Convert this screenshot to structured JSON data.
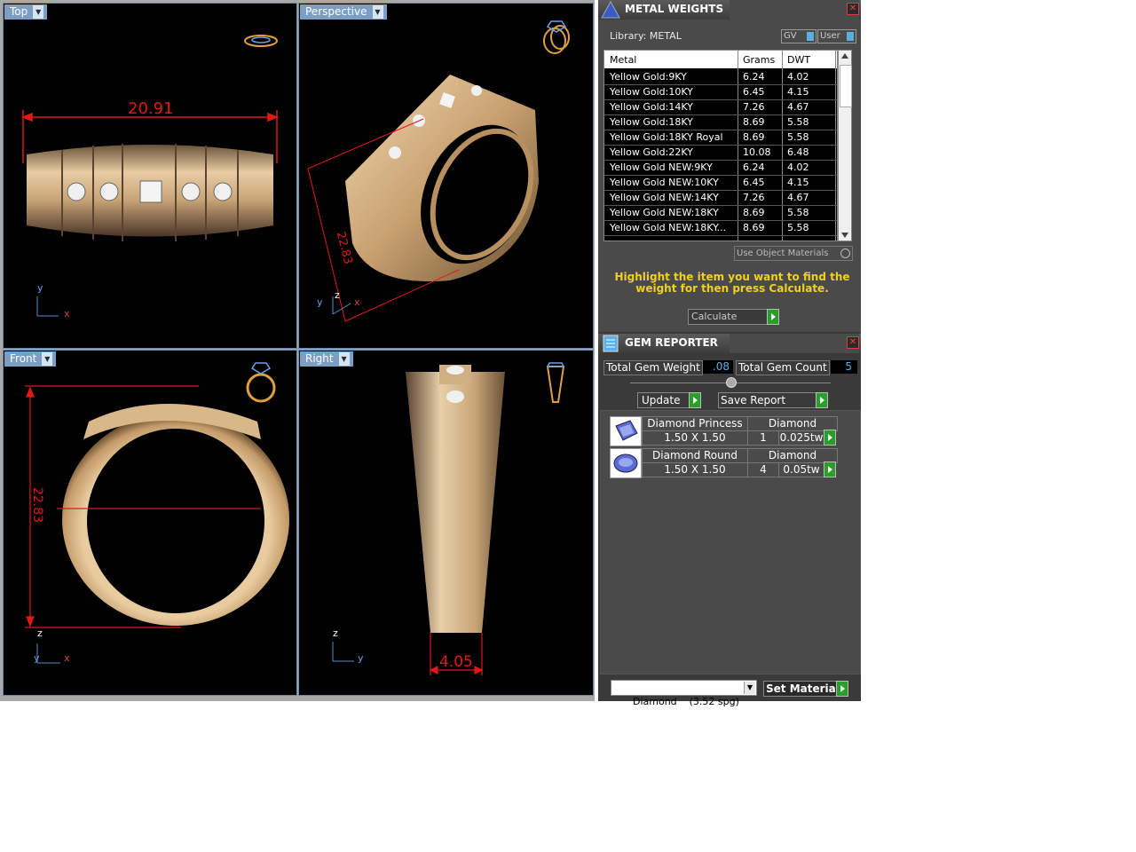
{
  "viewports": {
    "top": {
      "label": "Top",
      "dim": "20.91",
      "axis_y": "y",
      "axis_x": "x"
    },
    "perspective": {
      "label": "Perspective",
      "dim": "22.83",
      "axis_z": "z",
      "axis_y": "y",
      "axis_x": "x"
    },
    "front": {
      "label": "Front",
      "dim": "22.83",
      "axis_z": "z",
      "axis_y": "y",
      "axis_x": "x"
    },
    "right": {
      "label": "Right",
      "dim": "4.05",
      "axis_z": "z",
      "axis_y": "y"
    }
  },
  "metal_weights": {
    "title": "METAL WEIGHTS",
    "library": "Library: METAL",
    "gv_label": "GV",
    "user_label": "User",
    "columns": [
      "Metal",
      "Grams",
      "DWT"
    ],
    "rows": [
      {
        "metal": "Yellow Gold:9KY",
        "grams": "6.24",
        "dwt": "4.02"
      },
      {
        "metal": "Yellow Gold:10KY",
        "grams": "6.45",
        "dwt": "4.15"
      },
      {
        "metal": "Yellow Gold:14KY",
        "grams": "7.26",
        "dwt": "4.67"
      },
      {
        "metal": "Yellow Gold:18KY",
        "grams": "8.69",
        "dwt": "5.58"
      },
      {
        "metal": "Yellow Gold:18KY Royal",
        "grams": "8.69",
        "dwt": "5.58"
      },
      {
        "metal": "Yellow Gold:22KY",
        "grams": "10.08",
        "dwt": "6.48"
      },
      {
        "metal": "Yellow Gold NEW:9KY",
        "grams": "6.24",
        "dwt": "4.02"
      },
      {
        "metal": "Yellow Gold NEW:10KY",
        "grams": "6.45",
        "dwt": "4.15"
      },
      {
        "metal": "Yellow Gold NEW:14KY",
        "grams": "7.26",
        "dwt": "4.67"
      },
      {
        "metal": "Yellow Gold NEW:18KY",
        "grams": "8.69",
        "dwt": "5.58"
      },
      {
        "metal": "Yellow Gold NEW:18KY...",
        "grams": "8.69",
        "dwt": "5.58"
      }
    ],
    "use_object_materials": "Use Object Materials",
    "hint": "Highlight the item you want to find the weight for then press Calculate.",
    "calculate": "Calculate"
  },
  "gem_reporter": {
    "title": "GEM REPORTER",
    "total_weight_label": "Total Gem Weight",
    "total_weight": ".08",
    "total_count_label": "Total Gem Count",
    "total_count": "5",
    "update": "Update",
    "save_report": "Save Report",
    "gems": [
      {
        "name": "Diamond Princess",
        "material": "Diamond",
        "size": "1.50 X 1.50",
        "count": "1",
        "weight": "0.025tw"
      },
      {
        "name": "Diamond Round",
        "material": "Diamond",
        "size": "1.50 X 1.50",
        "count": "4",
        "weight": "0.05tw"
      }
    ],
    "material_select": "Diamond    (3.52 spg)",
    "set_material": "Set Material"
  },
  "colors": {
    "dimension": "#e01818",
    "gold": "#d8b888",
    "hint": "#f0d020"
  }
}
